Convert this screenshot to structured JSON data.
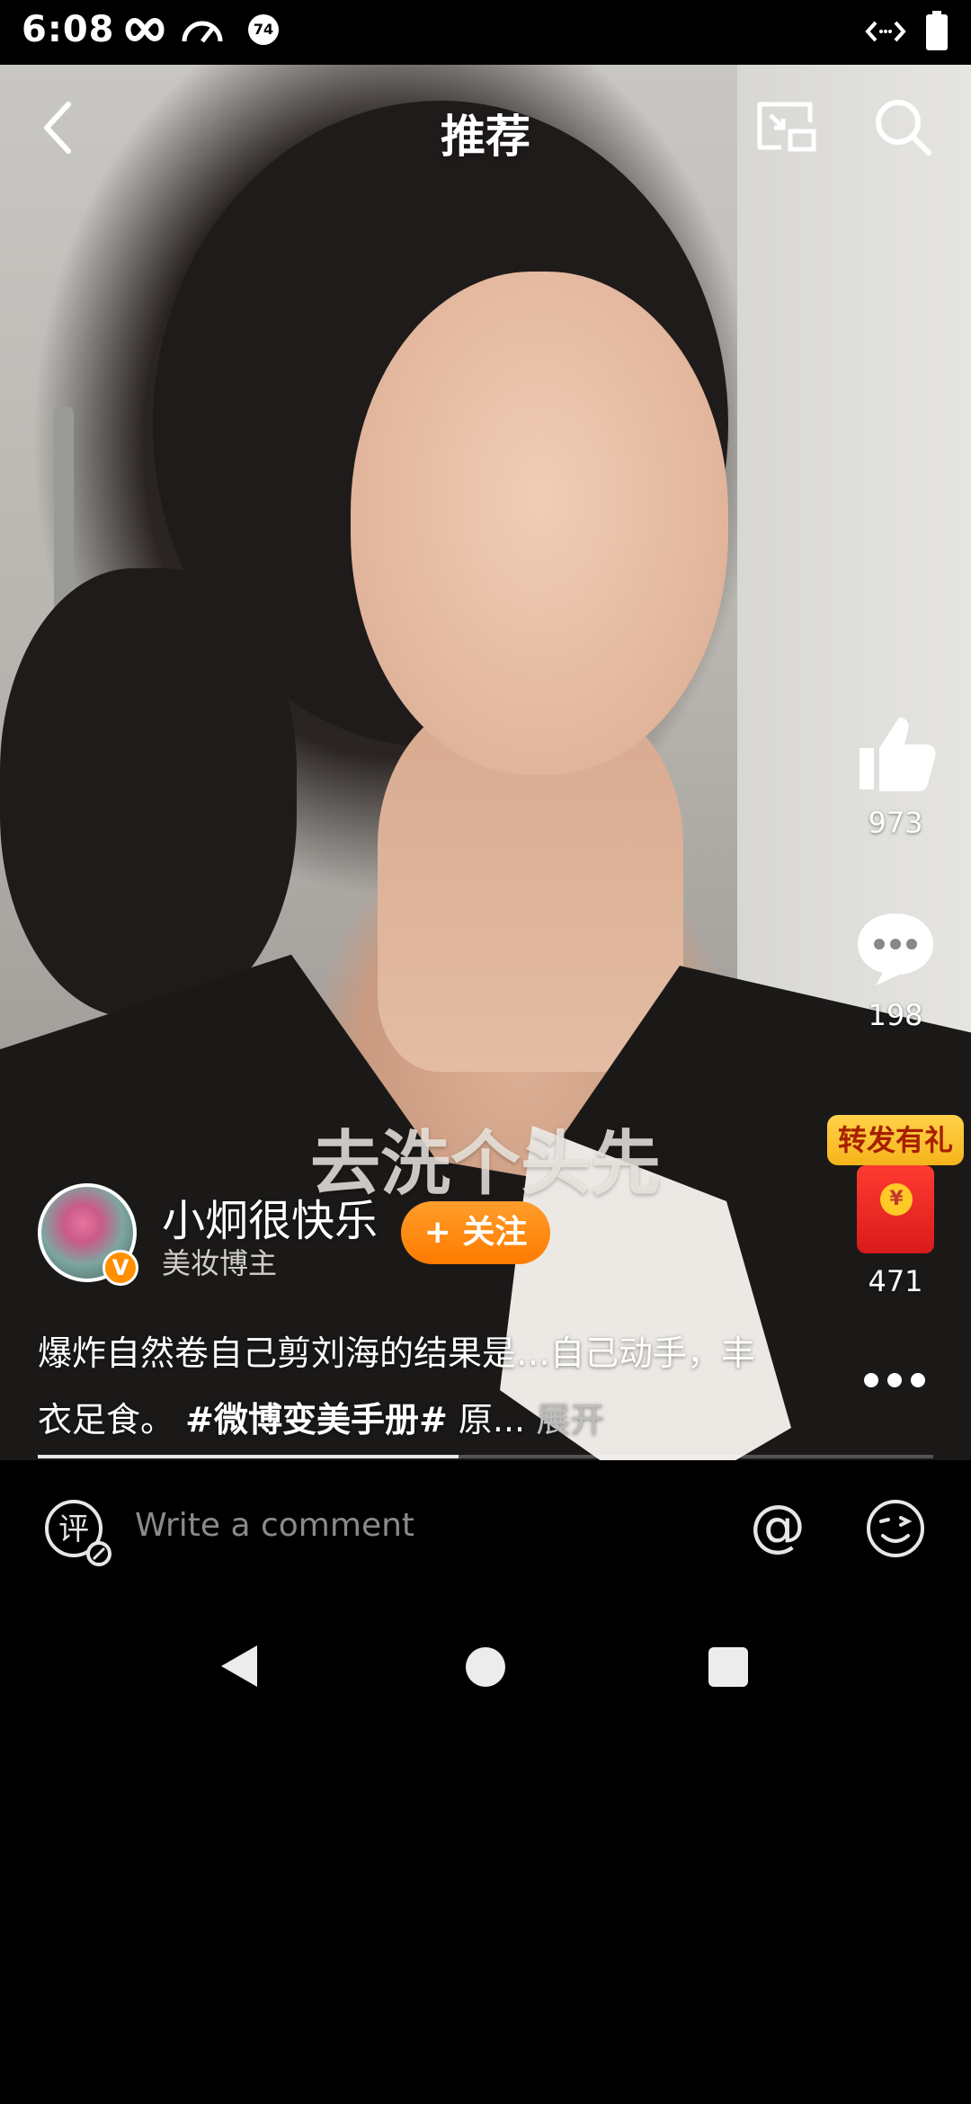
{
  "status_bar": {
    "time": "6:08",
    "icons": [
      "infinity-icon",
      "speedometer-icon",
      "notification-74-icon",
      "code-arrows-icon",
      "battery-icon"
    ],
    "badge_number": "74"
  },
  "header": {
    "title": "推荐",
    "back_icon": "chevron-left-icon",
    "cast_icon": "cast-screen-icon",
    "search_icon": "search-icon"
  },
  "video": {
    "subtitle": "去洗个头先",
    "progress_fraction": 0.47
  },
  "actions": {
    "like": {
      "icon": "thumbs-up-icon",
      "count": "973"
    },
    "comment": {
      "icon": "chat-bubble-icon",
      "count": "198"
    },
    "share": {
      "tag": "转发有礼",
      "icon": "red-envelope-icon",
      "count": "471",
      "coin_symbol": "¥"
    },
    "more_icon": "more-dots-icon"
  },
  "author": {
    "name": "小炯很快乐",
    "role": "美妆博主",
    "verified_badge": "V",
    "follow_label": "+ 关注"
  },
  "caption": {
    "text": "爆炸自然卷自己剪刘海的结果是…自己动手，丰衣足食。",
    "hashtag": "#微博变美手册#",
    "suffix": " 原...",
    "expand": " 展开"
  },
  "comment_bar": {
    "placeholder": "Write a comment",
    "comment_icon_char": "评",
    "at_symbol": "@",
    "emoji_icon": "wink-emoji-icon"
  },
  "colors": {
    "follow_orange": "#ff8a00",
    "gift_yellow": "#f8c22e",
    "envelope_red": "#e8261f"
  }
}
